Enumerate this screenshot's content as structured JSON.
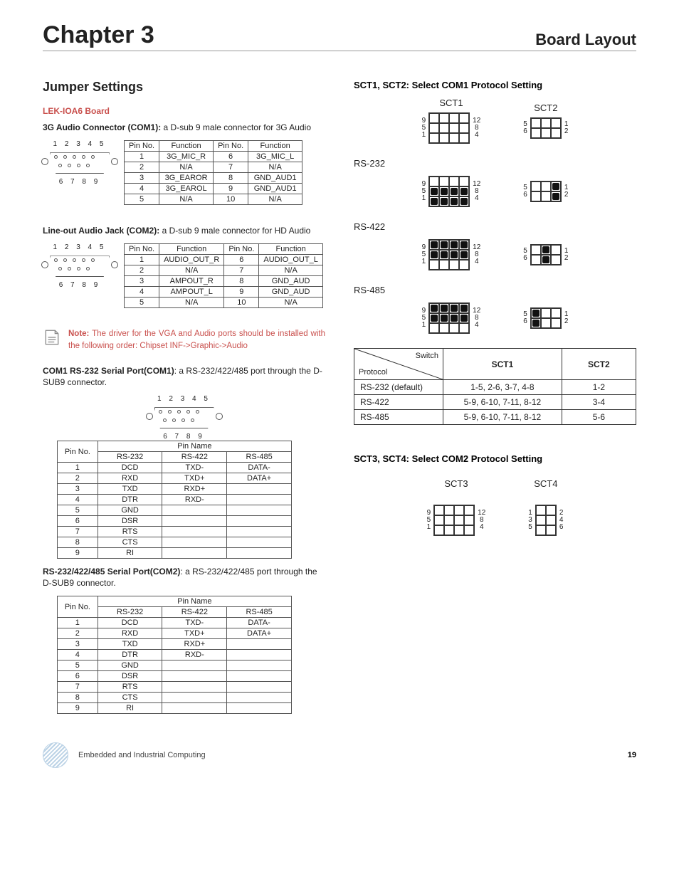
{
  "header": {
    "chapter": "Chapter 3",
    "right": "Board Layout"
  },
  "left": {
    "section_title": "Jumper Settings",
    "board_name": "LEK-IOA6 Board",
    "com1_audio": {
      "title": "3G Audio Connector (COM1):",
      "desc": " a D-sub 9 male connector for 3G Audio",
      "diagram_top": "1 2 3 4 5",
      "diagram_bottom": "6 7 8 9",
      "headers": [
        "Pin No.",
        "Function",
        "Pin No.",
        "Function"
      ],
      "rows": [
        [
          "1",
          "3G_MIC_R",
          "6",
          "3G_MIC_L"
        ],
        [
          "2",
          "N/A",
          "7",
          "N/A"
        ],
        [
          "3",
          "3G_EAROR",
          "8",
          "GND_AUD1"
        ],
        [
          "4",
          "3G_EAROL",
          "9",
          "GND_AUD1"
        ],
        [
          "5",
          "N/A",
          "10",
          "N/A"
        ]
      ]
    },
    "com2_audio": {
      "title": "Line-out Audio Jack (COM2):",
      "desc": " a D-sub 9 male connector for HD Audio",
      "diagram_top": "1 2 3 4 5",
      "diagram_bottom": "6 7 8 9",
      "headers": [
        "Pin No.",
        "Function",
        "Pin No.",
        "Function"
      ],
      "rows": [
        [
          "1",
          "AUDIO_OUT_R",
          "6",
          "AUDIO_OUT_L"
        ],
        [
          "2",
          "N/A",
          "7",
          "N/A"
        ],
        [
          "3",
          "AMPOUT_R",
          "8",
          "GND_AUD"
        ],
        [
          "4",
          "AMPOUT_L",
          "9",
          "GND_AUD"
        ],
        [
          "5",
          "N/A",
          "10",
          "N/A"
        ]
      ]
    },
    "note": {
      "label": "Note:",
      "text": " The driver for the VGA and Audio ports should be installed with the following order: Chipset INF->Graphic->Audio"
    },
    "com1_serial": {
      "title": "COM1 RS-232 Serial Port(COM1)",
      "desc": ": a RS-232/422/485 port through the D-SUB9 connector.",
      "diagram_top": "1 2 3 4 5",
      "diagram_bottom": "6 7 8 9"
    },
    "com2_serial": {
      "title": "RS-232/422/485 Serial Port(COM2)",
      "desc": ": a RS-232/422/485 port through the D-SUB9 connector."
    },
    "serial_table": {
      "headers": [
        "Pin No.",
        "Pin Name"
      ],
      "sub": [
        "",
        "RS-232",
        "RS-422",
        "RS-485"
      ],
      "rows": [
        [
          "1",
          "DCD",
          "TXD-",
          "DATA-"
        ],
        [
          "2",
          "RXD",
          "TXD+",
          "DATA+"
        ],
        [
          "3",
          "TXD",
          "RXD+",
          ""
        ],
        [
          "4",
          "DTR",
          "RXD-",
          ""
        ],
        [
          "5",
          "GND",
          "",
          ""
        ],
        [
          "6",
          "DSR",
          "",
          ""
        ],
        [
          "7",
          "RTS",
          "",
          ""
        ],
        [
          "8",
          "CTS",
          "",
          ""
        ],
        [
          "9",
          "RI",
          "",
          ""
        ]
      ]
    }
  },
  "right": {
    "sct12_title": "SCT1, SCT2: Select COM1 Protocol Setting",
    "sct1_label": "SCT1",
    "sct2_label": "SCT2",
    "rs232_label": "RS-232",
    "rs422_label": "RS-422",
    "rs485_label": "RS-485",
    "sct34_title": "SCT3, SCT4: Select COM2 Protocol Setting",
    "sct3_label": "SCT3",
    "sct4_label": "SCT4",
    "protocol_table": {
      "diag_top": "Switch",
      "diag_bottom": "Protocol",
      "hdr1": "SCT1",
      "hdr2": "SCT2",
      "rows": [
        [
          "RS-232 (default)",
          "1-5, 2-6, 3-7, 4-8",
          "1-2"
        ],
        [
          "RS-422",
          "5-9, 6-10, 7-11, 8-12",
          "3-4"
        ],
        [
          "RS-485",
          "5-9, 6-10, 7-11, 8-12",
          "5-6"
        ]
      ]
    },
    "sw_nums": {
      "sct1_left": [
        "9",
        "5",
        "1"
      ],
      "sct1_right": [
        "12",
        "8",
        "4"
      ],
      "sct2_left": [
        "5",
        "6"
      ],
      "sct2_right": [
        "1",
        "2"
      ],
      "sct4_left": [
        "1",
        "3",
        "5"
      ],
      "sct4_right": [
        "2",
        "4",
        "6"
      ]
    }
  },
  "footer": {
    "text": "Embedded and Industrial Computing",
    "page": "19"
  }
}
